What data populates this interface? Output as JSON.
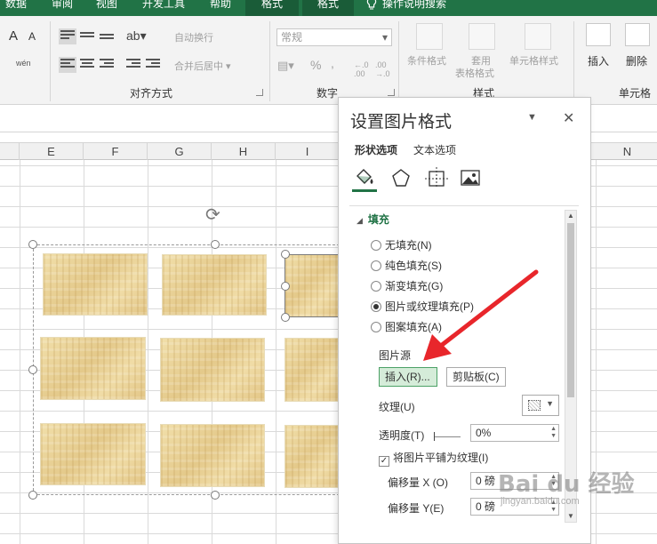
{
  "ribbon": {
    "tabs": [
      {
        "label": "数据"
      },
      {
        "label": "审阅"
      },
      {
        "label": "视图"
      },
      {
        "label": "开发工具"
      },
      {
        "label": "帮助"
      },
      {
        "label": "格式"
      },
      {
        "label": "格式"
      },
      {
        "label": "操作说明搜索"
      }
    ],
    "alignment": {
      "wrap_text": "自动换行",
      "merge_center": "合并后居中",
      "group_label": "对齐方式",
      "font_a_large": "A",
      "font_a_small": "A",
      "wen_label": "wén"
    },
    "number": {
      "format_value": "常规",
      "percent": "%",
      "comma": ",",
      "group_label": "数字"
    },
    "styles": {
      "conditional": "条件格式",
      "table_format_1": "套用",
      "table_format_2": "表格格式",
      "cell_styles": "单元格样式",
      "group_label": "样式"
    },
    "cells": {
      "insert": "插入",
      "delete": "删除",
      "group_label": "单元格"
    }
  },
  "sheet": {
    "columns": [
      "E",
      "F",
      "G",
      "H",
      "I",
      "N"
    ]
  },
  "pane": {
    "title": "设置图片格式",
    "tabs": [
      "形状选项",
      "文本选项"
    ],
    "section": "填充",
    "fill_options": [
      {
        "label": "无填充(N)",
        "selected": false
      },
      {
        "label": "纯色填充(S)",
        "selected": false
      },
      {
        "label": "渐变填充(G)",
        "selected": false
      },
      {
        "label": "图片或纹理填充(P)",
        "selected": true
      },
      {
        "label": "图案填充(A)",
        "selected": false
      }
    ],
    "source_label": "图片源",
    "insert_button": "插入(R)...",
    "clipboard_button": "剪贴板(C)",
    "texture_label": "纹理(U)",
    "transparency_label": "透明度(T)",
    "transparency_value": "0%",
    "tile_checkbox": "将图片平铺为纹理(I)",
    "tile_checked": true,
    "offset_x_label": "偏移量 X (O)",
    "offset_x_value": "0 磅",
    "offset_y_label": "偏移量 Y(E)",
    "offset_y_value": "0 磅"
  },
  "watermark": {
    "brand": "Bai du 经验",
    "url": "jingyan.baidu.com"
  },
  "colors": {
    "excel_green": "#217346",
    "arrow_red": "#e8262b",
    "selected_tab": "#1a5c38"
  },
  "icons": [
    "rotate-icon",
    "fill-line-icon",
    "effects-icon",
    "size-properties-icon",
    "picture-icon",
    "bulb-icon",
    "close-icon",
    "menu-down-icon"
  ]
}
